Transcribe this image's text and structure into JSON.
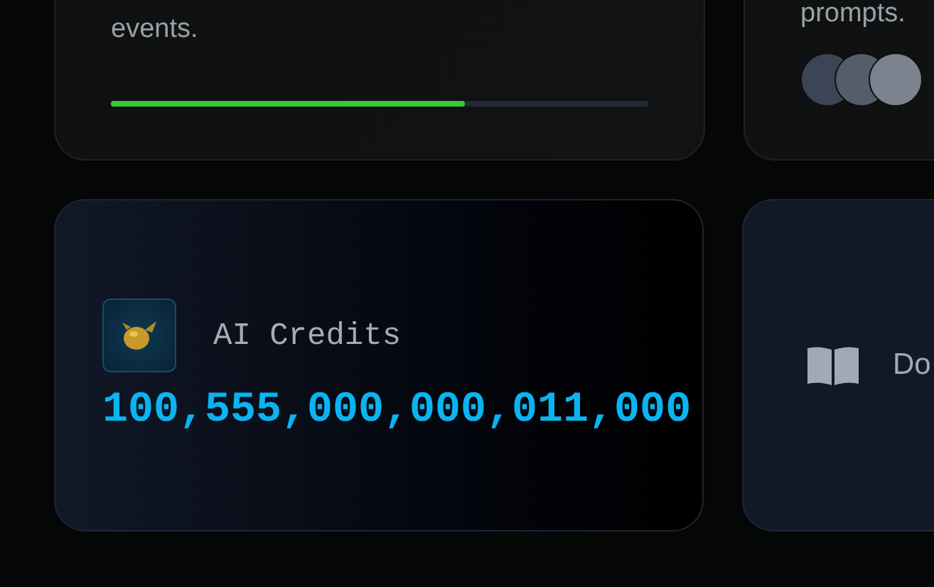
{
  "top_cards": [
    {
      "kind": "progress",
      "text": "events.",
      "level": 0.66
    },
    {
      "kind": "avatars",
      "text": "prompts.",
      "avatars": [
        {
          "color": "#3b4555"
        },
        {
          "color": "#535d6b"
        },
        {
          "color": "#7c838e"
        }
      ]
    }
  ],
  "credits_card": {
    "label": "AI Credits",
    "value": "100,555,000,000,011,000"
  },
  "docs_card": {
    "label": "Do"
  }
}
